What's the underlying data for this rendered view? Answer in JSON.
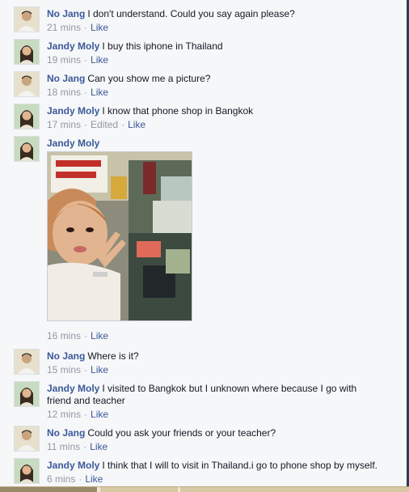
{
  "comments": [
    {
      "author": "No Jang",
      "text": "I don't understand. Could you say again please?",
      "time": "21 mins",
      "like": "Like",
      "avatar": "male"
    },
    {
      "author": "Jandy Moly",
      "text": "I buy this iphone in Thailand",
      "time": "19 mins",
      "like": "Like",
      "avatar": "female"
    },
    {
      "author": "No Jang",
      "text": "Can you show me a picture?",
      "time": "18 mins",
      "like": "Like",
      "avatar": "male"
    },
    {
      "author": "Jandy Moly",
      "text": "I know that phone shop in Bangkok",
      "time": "17 mins",
      "edited": "Edited",
      "like": "Like",
      "avatar": "female"
    },
    {
      "author": "Jandy Moly",
      "text": "",
      "time": "16 mins",
      "like": "Like",
      "avatar": "female",
      "photo": "selfie in phone shop"
    },
    {
      "author": "No Jang",
      "text": "Where is it?",
      "time": "15 mins",
      "like": "Like",
      "avatar": "male"
    },
    {
      "author": "Jandy Moly",
      "text": "I visited to Bangkok but I unknown where because I go with friend and teacher",
      "time": "12 mins",
      "like": "Like",
      "avatar": "female"
    },
    {
      "author": "No Jang",
      "text": "Could you ask your friends or your teacher?",
      "time": "11 mins",
      "like": "Like",
      "avatar": "male"
    },
    {
      "author": "Jandy Moly",
      "text": "I think that I will to visit in Thailand.i go to phone shop by myself.",
      "time": "6 mins",
      "like": "Like",
      "avatar": "female"
    }
  ],
  "colors": {
    "link": "#3b5998",
    "meta": "#9197a3",
    "background": "#f6f7f9"
  }
}
